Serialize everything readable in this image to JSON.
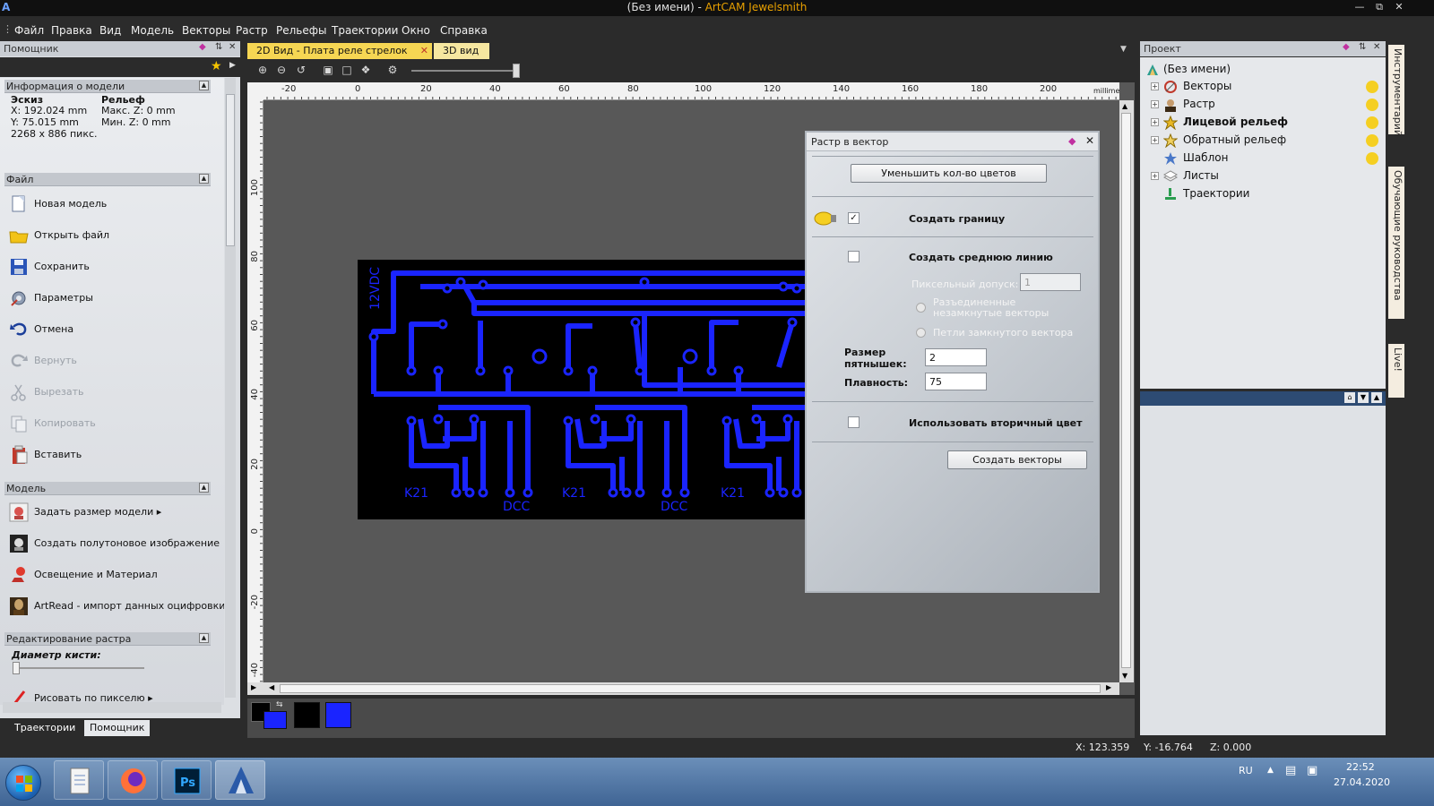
{
  "window": {
    "title_doc": "(Без имени)",
    "title_sep": " - ",
    "title_app": "ArtCAM Jewelsmith",
    "min_icon": "minimize-icon",
    "restore_icon": "restore-icon",
    "close_icon": "close-icon"
  },
  "menu": [
    "Файл",
    "Правка",
    "Вид",
    "Модель",
    "Векторы",
    "Растр",
    "Рельефы",
    "Траектории",
    "Окно",
    "Справка"
  ],
  "left_panel": {
    "title": "Помощник",
    "info_section": "Информация о модели",
    "info": {
      "sketch_label": "Эскиз",
      "relief_label": "Рельеф",
      "x": "X: 192.024 mm",
      "y": "Y: 75.015 mm",
      "pixels": "2268 x 886 пикс.",
      "max_z": "Макс. Z: 0 mm",
      "min_z": "Мин. Z: 0 mm"
    },
    "file_section": "Файл",
    "file_items": [
      {
        "label": "Новая модель",
        "icon": "new-model-icon",
        "enabled": true
      },
      {
        "label": "Открыть файл",
        "icon": "open-folder-icon",
        "enabled": true
      },
      {
        "label": "Сохранить",
        "icon": "save-icon",
        "enabled": true
      },
      {
        "label": "Параметры",
        "icon": "settings-icon",
        "enabled": true
      },
      {
        "label": "Отмена",
        "icon": "undo-icon",
        "enabled": true
      },
      {
        "label": "Вернуть",
        "icon": "redo-icon",
        "enabled": false
      },
      {
        "label": "Вырезать",
        "icon": "cut-icon",
        "enabled": false
      },
      {
        "label": "Копировать",
        "icon": "copy-icon",
        "enabled": false
      },
      {
        "label": "Вставить",
        "icon": "paste-icon",
        "enabled": true
      }
    ],
    "model_section": "Модель",
    "model_items": [
      {
        "label": "Задать размер модели ▸",
        "icon": "model-size-icon"
      },
      {
        "label": "Создать полутоновое изображение",
        "icon": "grayscale-icon"
      },
      {
        "label": "Освещение и Материал",
        "icon": "lighting-icon"
      },
      {
        "label": "ArtRead - импорт данных оцифровки",
        "icon": "artread-icon"
      }
    ],
    "raster_section": "Редактирование растра",
    "brush_label": "Диаметр кисти:",
    "draw_pixel": "Рисовать по пикселю ▸",
    "tabs": [
      "Траектории",
      "Помощник"
    ]
  },
  "document": {
    "tabs": [
      {
        "label": "2D Вид - Плата реле стрелок",
        "active": true
      },
      {
        "label": "3D вид",
        "active": false
      }
    ],
    "units": "millimetres",
    "h_ruler": [
      "-20",
      "0",
      "20",
      "40",
      "60",
      "80",
      "100",
      "120",
      "140",
      "160",
      "180",
      "200"
    ],
    "v_ruler": [
      "100",
      "80",
      "60",
      "40",
      "20",
      "0",
      "-20",
      "-40"
    ],
    "pcb_labels": {
      "vdc": "12VDC",
      "k21": "K21",
      "dcc": "DCC"
    },
    "colors": {
      "primary": "#000000",
      "secondary": "#1a24ff",
      "palette": [
        "#000000",
        "#1a24ff"
      ]
    }
  },
  "dialog": {
    "title": "Растр в вектор",
    "reduce_colors_button": "Уменьшить кол-во цветов",
    "create_border": {
      "label": "Создать границу",
      "checked": true
    },
    "create_centerline": {
      "label": "Создать среднюю линию",
      "checked": false
    },
    "pixel_tolerance_label": "Пиксельный допуск:",
    "pixel_tolerance_value": "1",
    "radio_open": "Разъединенные незамкнутые векторы",
    "radio_closed": "Петли замкнутого вектора",
    "speckle_label_1": "Размер",
    "speckle_label_2": "пятнышек:",
    "speckle_value": "2",
    "smoothness_label": "Плавность:",
    "smoothness_value": "75",
    "secondary_color": {
      "label": "Использовать вторичный цвет",
      "checked": false
    },
    "create_vectors_button": "Создать векторы"
  },
  "project": {
    "title": "Проект",
    "root": "(Без имени)",
    "nodes": [
      {
        "label": "Векторы",
        "bold": false,
        "icon": "vectors-icon",
        "lamp": true
      },
      {
        "label": "Растр",
        "bold": false,
        "icon": "raster-icon",
        "lamp": true
      },
      {
        "label": "Лицевой рельеф",
        "bold": true,
        "icon": "front-relief-icon",
        "lamp": true
      },
      {
        "label": "Обратный рельеф",
        "bold": false,
        "icon": "back-relief-icon",
        "lamp": true
      },
      {
        "label": "Шаблон",
        "bold": false,
        "icon": "template-icon",
        "lamp": true
      },
      {
        "label": "Листы",
        "bold": false,
        "icon": "sheets-icon",
        "lamp": false
      },
      {
        "label": "Траектории",
        "bold": false,
        "icon": "toolpaths-icon",
        "lamp": false
      }
    ]
  },
  "side_tabs": [
    "Инструментарий",
    "Обучающие руководства",
    "Live!"
  ],
  "status": {
    "x": "X: 123.359",
    "y": "Y: -16.764",
    "z": "Z: 0.000"
  },
  "taskbar": {
    "lang": "RU",
    "time": "22:52",
    "date": "27.04.2020"
  }
}
